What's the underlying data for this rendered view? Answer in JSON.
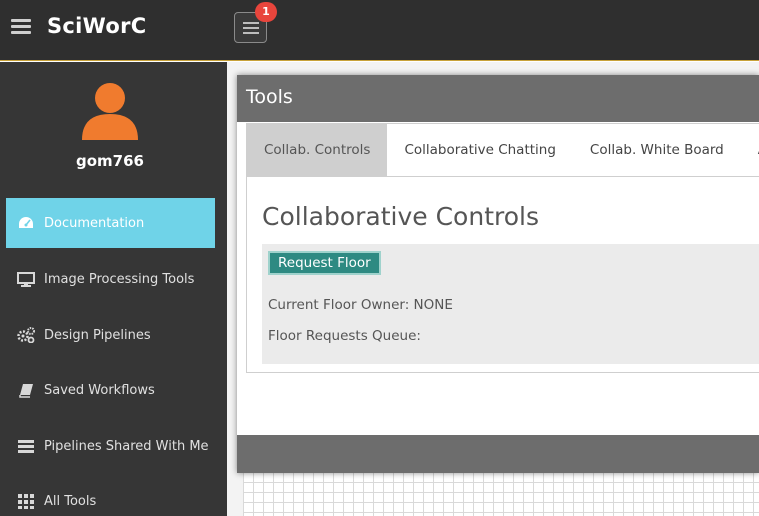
{
  "app": {
    "title": "SciWorC",
    "notification_count": "1"
  },
  "sidebar": {
    "username": "gom766",
    "items": [
      {
        "label": "Documentation",
        "icon": "dashboard-icon"
      },
      {
        "label": "Image Processing Tools",
        "icon": "monitor-icon"
      },
      {
        "label": "Design Pipelines",
        "icon": "gears-icon"
      },
      {
        "label": "Saved Workflows",
        "icon": "book-icon"
      },
      {
        "label": "Pipelines Shared With Me",
        "icon": "layers-icon"
      },
      {
        "label": "All Tools",
        "icon": "grid-icon"
      }
    ],
    "active_index": 0
  },
  "tools_window": {
    "title": "Tools",
    "tabs": [
      "Collab. Controls",
      "Collaborative Chatting",
      "Collab. White Board",
      "Au"
    ],
    "active_tab": 0,
    "section_title": "Collaborative Controls",
    "request_floor_label": "Request Floor",
    "current_floor_owner": "Current Floor Owner: NONE",
    "floor_requests_queue": "Floor Requests Queue:"
  },
  "colors": {
    "topbar": "#2f2f2f",
    "sidebar": "#363636",
    "active_nav": "#6fd3e8",
    "badge": "#e8453c",
    "avatar": "#f07b2e",
    "button": "#2e8a82",
    "window_header": "#6d6d6d"
  }
}
